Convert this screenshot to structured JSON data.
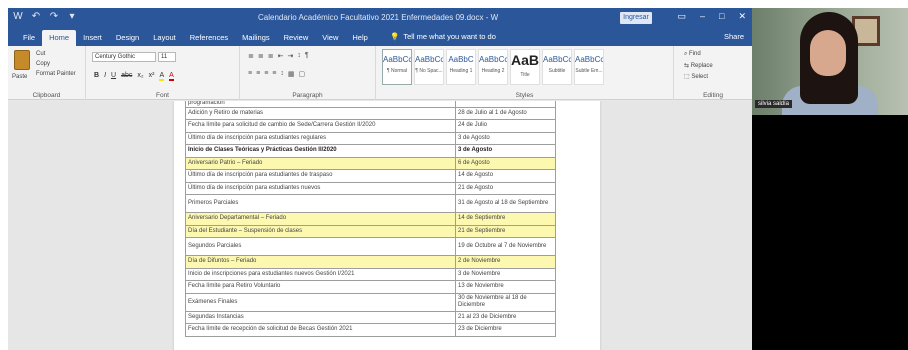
{
  "window": {
    "title": "Calendario Académico Facultativo 2021 Enfermedades 09.docx - Word",
    "signin": "Ingresar",
    "controls": {
      "ribbon_options": "▭",
      "minimize": "–",
      "restore": "□",
      "close": "✕"
    }
  },
  "quick_access": [
    "W",
    "↶",
    "↷",
    "▾"
  ],
  "tabs": [
    "File",
    "Home",
    "Insert",
    "Design",
    "Layout",
    "References",
    "Mailings",
    "Review",
    "View",
    "Help"
  ],
  "active_tab": "Home",
  "tell_me": "Tell me what you want to do",
  "share": "Share",
  "ribbon": {
    "clipboard": {
      "paste": "Paste",
      "cut": "Cut",
      "copy": "Copy",
      "format_painter": "Format Painter",
      "label": "Clipboard"
    },
    "font": {
      "name": "Century Gothic",
      "size": "11",
      "label": "Font",
      "buttons": [
        "B",
        "I",
        "U",
        "abc",
        "x₂",
        "x²",
        "A",
        "A"
      ]
    },
    "paragraph": {
      "label": "Paragraph",
      "row1": [
        "≣",
        "≣",
        "≣",
        "⇤",
        "⇥",
        "↕",
        "¶"
      ],
      "row2": [
        "≡",
        "≡",
        "≡",
        "≡",
        "↕",
        "▦",
        "▢"
      ]
    },
    "styles": {
      "label": "Styles",
      "items": [
        {
          "sample": "AaBbCcDc",
          "name": "¶ Normal"
        },
        {
          "sample": "AaBbCcDc",
          "name": "¶ No Spac..."
        },
        {
          "sample": "AaBbC",
          "name": "Heading 1"
        },
        {
          "sample": "AaBbCc",
          "name": "Heading 2"
        },
        {
          "sample": "AaB",
          "name": "Title"
        },
        {
          "sample": "AaBbCcD",
          "name": "Subtitle"
        },
        {
          "sample": "AaBbCcD",
          "name": "Subtle Em..."
        }
      ]
    },
    "editing": {
      "find": "Find",
      "replace": "Replace",
      "select": "Select",
      "label": "Editing"
    }
  },
  "schedule": {
    "rows": [
      {
        "desc": "programación",
        "date": "",
        "style": "cut"
      },
      {
        "desc": "Adición y Retiro de materias",
        "date": "28 de Julio al 1 de Agosto",
        "style": ""
      },
      {
        "desc": "Fecha límite para solicitud de cambio de Sede/Carrera Gestión II/2020",
        "date": "24 de Julio",
        "style": ""
      },
      {
        "desc": "Último día de inscripción para estudiantes regulares",
        "date": "3 de Agosto",
        "style": ""
      },
      {
        "desc": "Inicio de Clases Teóricas y Prácticas Gestión II/2020",
        "date": "3 de Agosto",
        "style": "bold"
      },
      {
        "desc": "Aniversario Patrio – Feriado",
        "date": "6 de Agosto",
        "style": "hl"
      },
      {
        "desc": "Último día de inscripción para estudiantes de traspaso",
        "date": "14 de Agosto",
        "style": ""
      },
      {
        "desc": "Último día de inscripción para estudiantes nuevos",
        "date": "21 de Agosto",
        "style": ""
      },
      {
        "desc": "Primeros Parciales",
        "date": "31 de Agosto al 18 de Septiembre",
        "style": "tall"
      },
      {
        "desc": "Aniversario Departamental – Feriado",
        "date": "14 de Septiembre",
        "style": "hl"
      },
      {
        "desc": "Día del Estudiante – Suspensión de clases",
        "date": "21 de Septiembre",
        "style": "hl"
      },
      {
        "desc": "Segundos Parciales",
        "date": "19 de Octubre al 7 de Noviembre",
        "style": "tall"
      },
      {
        "desc": "Día de Difuntos – Feriado",
        "date": "2 de Noviembre",
        "style": "hl"
      },
      {
        "desc": "Inicio de inscripciones para estudiantes nuevos Gestión I/2021",
        "date": "3 de Noviembre",
        "style": ""
      },
      {
        "desc": "Fecha límite para Retiro Voluntario",
        "date": "13 de Noviembre",
        "style": ""
      },
      {
        "desc": "Exámenes Finales",
        "date": "30 de Noviembre al 18 de Diciembre",
        "style": "tall"
      },
      {
        "desc": "Segundas Instancias",
        "date": "21 al 23 de Diciembre",
        "style": ""
      },
      {
        "desc": "Fecha límite de recepción de solicitud de Becas Gestión 2021",
        "date": "23 de Diciembre",
        "style": ""
      }
    ]
  },
  "camera": {
    "participant_name": "silvia saldía"
  },
  "colors": {
    "word_blue": "#2b579a",
    "highlight": "#fdf8b0"
  }
}
